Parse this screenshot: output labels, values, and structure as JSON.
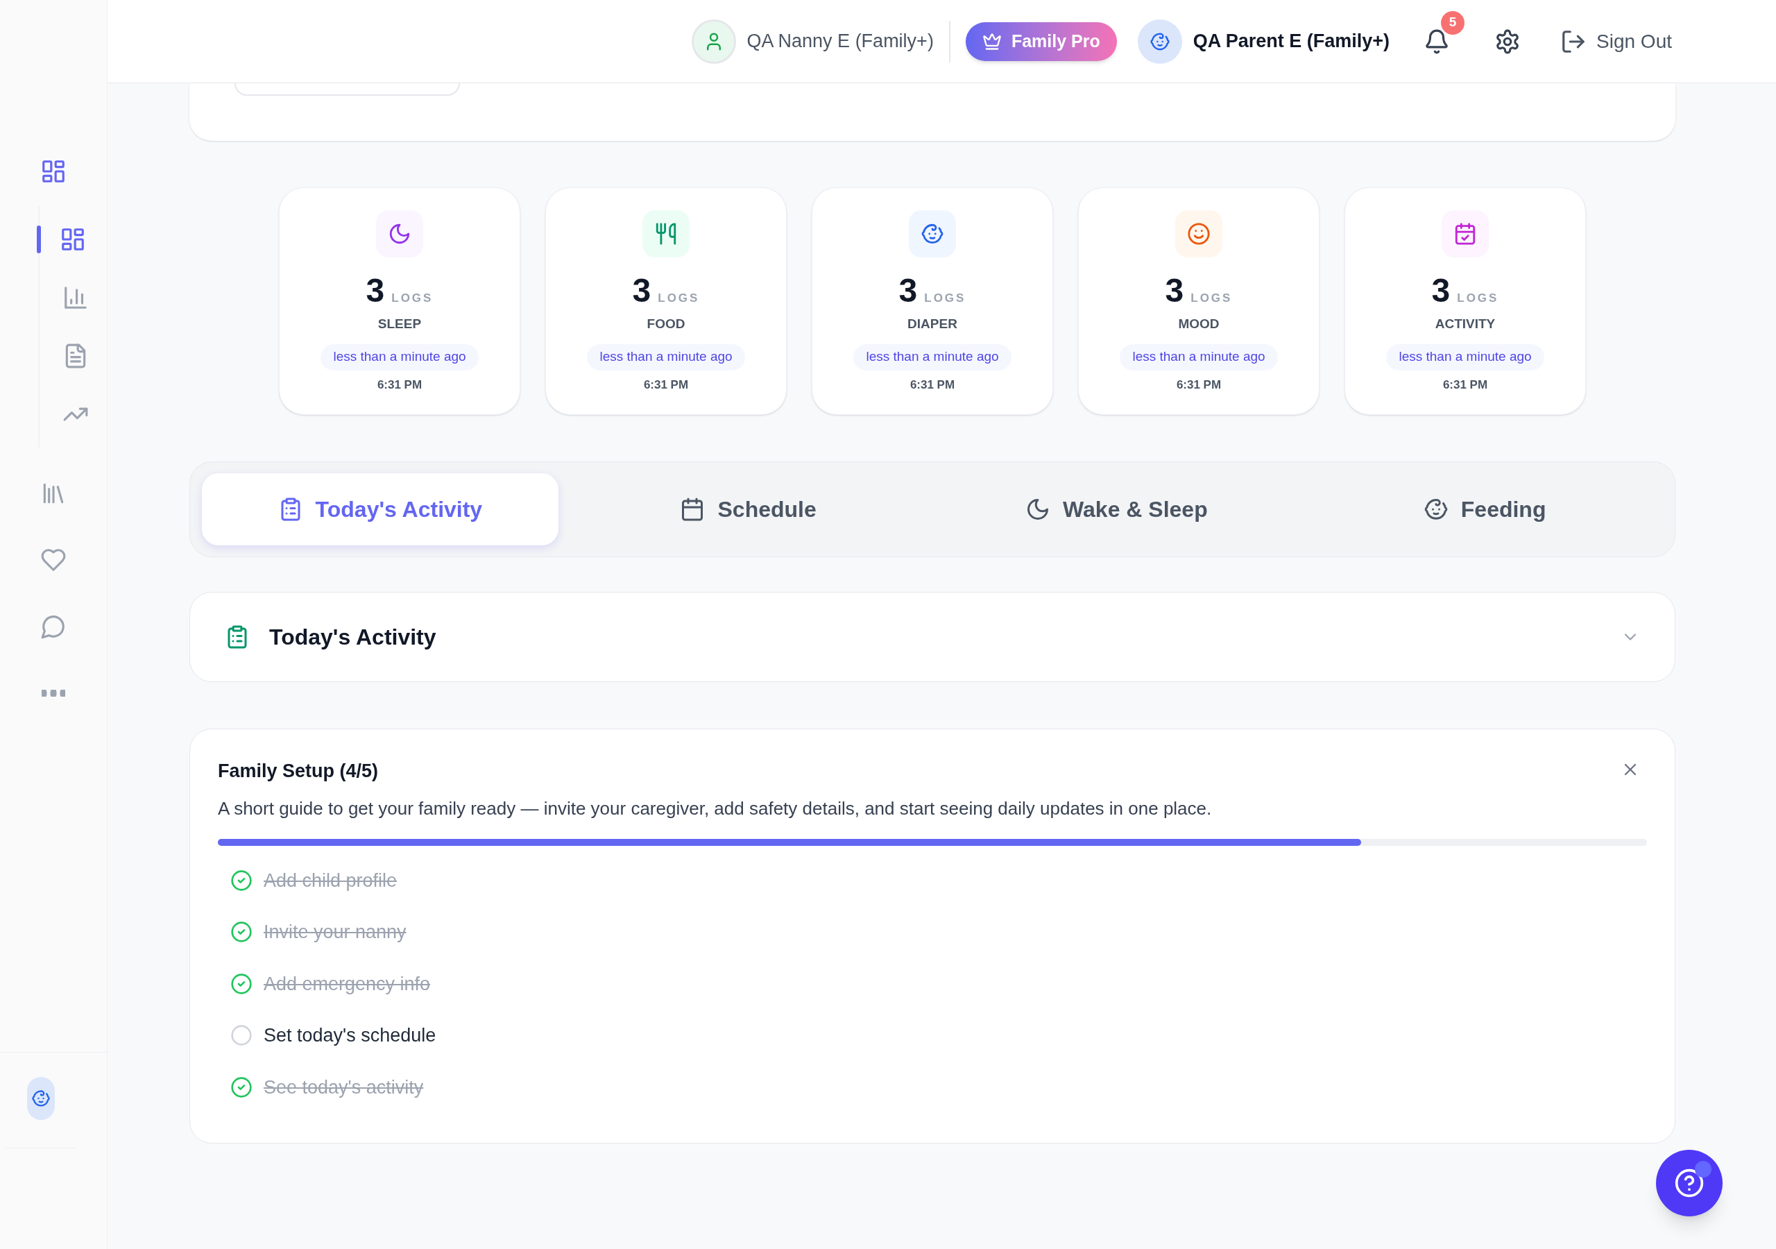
{
  "sidebar": {
    "items": [
      {
        "kind": "dashboard",
        "selected": true,
        "expanded": true,
        "children": [
          {
            "kind": "dashboard",
            "selected": true
          },
          {
            "kind": "chart",
            "selected": false
          },
          {
            "kind": "document",
            "selected": false
          },
          {
            "kind": "trend",
            "selected": false
          }
        ]
      },
      {
        "kind": "library",
        "selected": false
      },
      {
        "kind": "heart",
        "selected": false
      },
      {
        "kind": "chat",
        "selected": false
      },
      {
        "kind": "more",
        "selected": false
      }
    ],
    "profile": {
      "kind": "baby"
    }
  },
  "header": {
    "nanny": {
      "name": "QA Nanny E (Family+)"
    },
    "plan_badge": "Family Pro",
    "parent": {
      "name": "QA Parent E (Family+)"
    },
    "notifications": {
      "count": "5"
    },
    "sign_out": "Sign Out"
  },
  "stats": [
    {
      "kind": "sleep",
      "count": "3",
      "unit": "LOGS",
      "label": "SLEEP",
      "relative": "less than a minute ago",
      "time": "6:31 PM"
    },
    {
      "kind": "food",
      "count": "3",
      "unit": "LOGS",
      "label": "FOOD",
      "relative": "less than a minute ago",
      "time": "6:31 PM"
    },
    {
      "kind": "diaper",
      "count": "3",
      "unit": "LOGS",
      "label": "DIAPER",
      "relative": "less than a minute ago",
      "time": "6:31 PM"
    },
    {
      "kind": "mood",
      "count": "3",
      "unit": "LOGS",
      "label": "MOOD",
      "relative": "less than a minute ago",
      "time": "6:31 PM"
    },
    {
      "kind": "activity",
      "count": "3",
      "unit": "LOGS",
      "label": "ACTIVITY",
      "relative": "less than a minute ago",
      "time": "6:31 PM"
    }
  ],
  "tabs": [
    {
      "kind": "activity",
      "label": "Today's Activity",
      "selected": true
    },
    {
      "kind": "schedule",
      "label": "Schedule",
      "selected": false
    },
    {
      "kind": "sleep",
      "label": "Wake & Sleep",
      "selected": false
    },
    {
      "kind": "feeding",
      "label": "Feeding",
      "selected": false
    }
  ],
  "section": {
    "title": "Today's Activity",
    "expanded": false
  },
  "setup": {
    "title": "Family Setup (4/5)",
    "description": "A short guide to get your family ready — invite your caregiver, add safety details, and start seeing daily updates in one place.",
    "level": 0.8,
    "steps": [
      {
        "label": "Add child profile",
        "done": true
      },
      {
        "label": "Invite your nanny",
        "done": true
      },
      {
        "label": "Add emergency info",
        "done": true
      },
      {
        "label": "Set today's schedule",
        "done": false
      },
      {
        "label": "See today's activity",
        "done": true
      }
    ]
  }
}
